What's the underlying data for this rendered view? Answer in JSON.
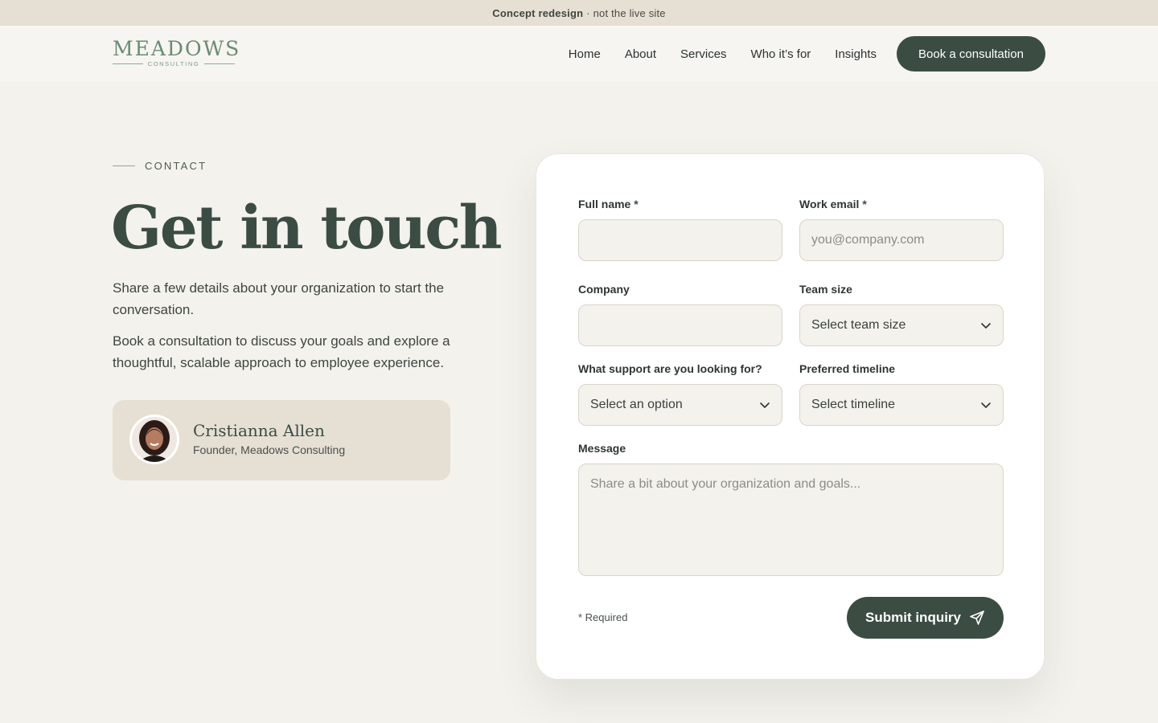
{
  "banner": {
    "strong": "Concept redesign",
    "text": "· not the live site"
  },
  "logo": {
    "main": "MEADOWS",
    "sub": "CONSULTING"
  },
  "nav": {
    "links": [
      "Home",
      "About",
      "Services",
      "Who it’s for",
      "Insights"
    ],
    "cta": "Book a consultation"
  },
  "hero": {
    "eyebrow": "CONTACT",
    "title": "Get in touch",
    "lead1": "Share a few details about your organization to start the conversation.",
    "lead2": "Book a consultation to discuss your goals and explore a thoughtful, scalable approach to employee experience."
  },
  "person": {
    "name": "Cristianna Allen",
    "role": "Founder, Meadows Consulting"
  },
  "form": {
    "full_name": {
      "label": "Full name",
      "required": "*",
      "value": "",
      "placeholder": ""
    },
    "work_email": {
      "label": "Work email",
      "required": "*",
      "value": "",
      "placeholder": "you@company.com"
    },
    "company": {
      "label": "Company",
      "value": "",
      "placeholder": ""
    },
    "team_size": {
      "label": "Team size",
      "selected": "Select team size"
    },
    "support": {
      "label": "What support are you looking for?",
      "selected": "Select an option"
    },
    "timeline": {
      "label": "Preferred timeline",
      "selected": "Select timeline"
    },
    "message": {
      "label": "Message",
      "value": "",
      "placeholder": "Share a bit about your organization and goals..."
    },
    "required_note": "* Required",
    "submit": "Submit inquiry"
  },
  "icons": {
    "chevron": "chevron-down-icon",
    "send": "send-icon"
  },
  "colors": {
    "accent": "#3b4c43",
    "background": "#f4f2ed",
    "banner": "#e6dfd3",
    "card": "#ffffff"
  }
}
